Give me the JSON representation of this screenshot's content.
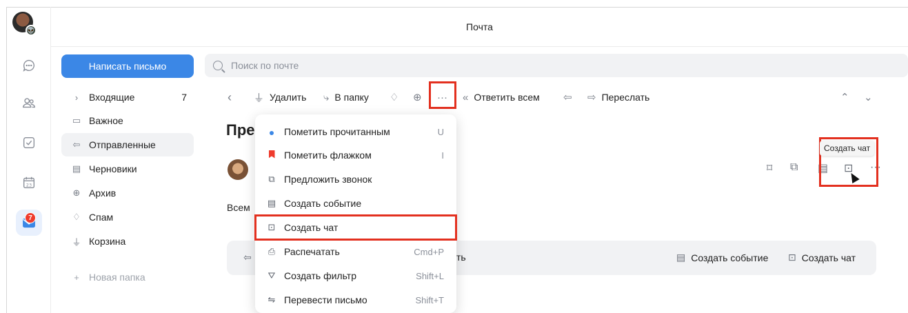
{
  "app": {
    "title": "Почта",
    "mail_badge": "7"
  },
  "compose_label": "Написать письмо",
  "folders": [
    {
      "label": "Входящие",
      "count": "7",
      "icon": "chevron-right-icon"
    },
    {
      "label": "Важное",
      "icon": "folder-icon"
    },
    {
      "label": "Отправленные",
      "icon": "sent-icon"
    },
    {
      "label": "Черновики",
      "icon": "draft-icon"
    },
    {
      "label": "Архив",
      "icon": "archive-icon"
    },
    {
      "label": "Спам",
      "icon": "spam-icon"
    },
    {
      "label": "Корзина",
      "icon": "trash-icon"
    }
  ],
  "new_folder": "Новая папка",
  "search": {
    "placeholder": "Поиск по почте"
  },
  "toolbar": {
    "delete": "Удалить",
    "move": "В папку",
    "reply_all": "Ответить всем",
    "forward": "Переслать"
  },
  "message": {
    "subject_partial": "Пре",
    "body_partial": "Всем"
  },
  "menu": [
    {
      "label": "Пометить прочитанным",
      "shortcut": "U"
    },
    {
      "label": "Пометить флажком",
      "shortcut": "I"
    },
    {
      "label": "Предложить звонок",
      "shortcut": ""
    },
    {
      "label": "Создать событие",
      "shortcut": ""
    },
    {
      "label": "Создать чат",
      "shortcut": ""
    },
    {
      "label": "Распечатать",
      "shortcut": "Cmd+P"
    },
    {
      "label": "Создать фильтр",
      "shortcut": "Shift+L"
    },
    {
      "label": "Перевести письмо",
      "shortcut": "Shift+T"
    }
  ],
  "reply_bar": {
    "partial": "ть",
    "create_event": "Создать событие",
    "create_chat": "Создать чат"
  },
  "tooltip": "Создать чат",
  "colors": {
    "accent": "#3b87e6",
    "highlight": "#e3301f",
    "badge": "#ef3b2d"
  }
}
